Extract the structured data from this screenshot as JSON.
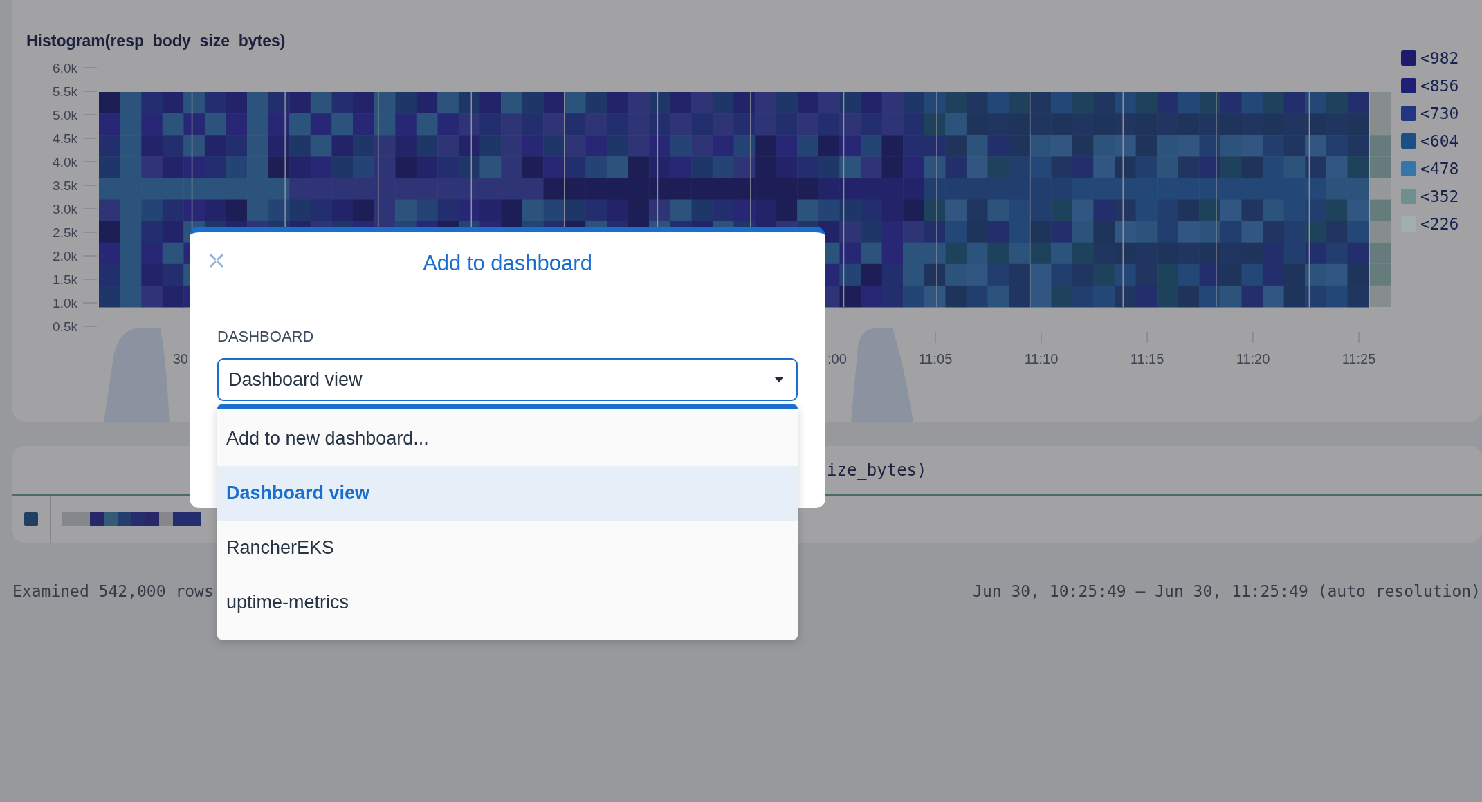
{
  "chart": {
    "title": "Histogram(resp_body_size_bytes)",
    "y_axis": [
      "6.0k",
      "5.5k",
      "5.0k",
      "4.5k",
      "4.0k",
      "3.5k",
      "3.0k",
      "2.5k",
      "2.0k",
      "1.5k",
      "1.0k",
      "0.5k"
    ],
    "x_axis": [
      "30",
      ":00",
      "11:05",
      "11:10",
      "11:15",
      "11:20",
      "11:25"
    ],
    "legend": [
      {
        "label": "<982",
        "color": "#1c1c6a"
      },
      {
        "label": "<856",
        "color": "#1e2074"
      },
      {
        "label": "<730",
        "color": "#213580"
      },
      {
        "label": "<604",
        "color": "#1d4f86"
      },
      {
        "label": "<478",
        "color": "#3575aa"
      },
      {
        "label": "<352",
        "color": "#6d908e"
      },
      {
        "label": "<226",
        "color": "#a4aeab"
      }
    ]
  },
  "table_card": {
    "header": "ize_bytes)"
  },
  "footer": {
    "left": "Examined 542,000 rows",
    "right": "Jun 30, 10:25:49 — Jun 30, 11:25:49 (auto resolution)"
  },
  "dialog": {
    "title": "Add to dashboard",
    "field_label": "DASHBOARD",
    "select": {
      "value": "Dashboard view",
      "expanded": true
    },
    "options": [
      {
        "label": "Add to new dashboard...",
        "selected": false
      },
      {
        "label": "Dashboard view",
        "selected": true
      },
      {
        "label": "RancherEKS",
        "selected": false
      },
      {
        "label": "uptime-metrics",
        "selected": false
      }
    ]
  }
}
